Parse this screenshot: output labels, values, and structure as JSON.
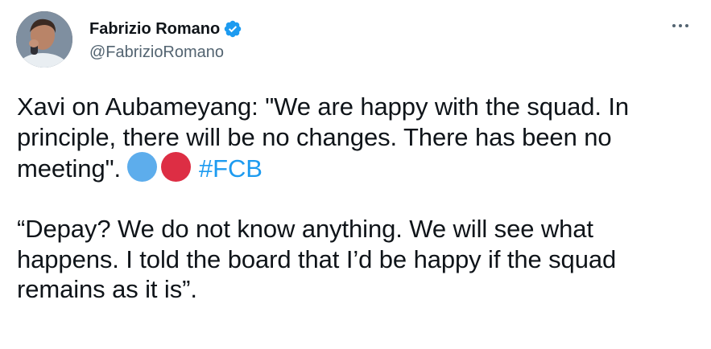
{
  "author": {
    "display_name": "Fabrizio Romano",
    "handle": "@FabrizioRomano",
    "verified": true,
    "verified_color": "#1d9bf0"
  },
  "icons": {
    "avatar": "profile-photo",
    "verified": "verified-badge-icon",
    "more": "more-options-icon"
  },
  "tweet": {
    "paragraph1_text": "Xavi on Aubameyang: \"We are happy with the squad. In principle, there will be no changes. There has been no meeting\".",
    "emoji1": "blue-circle",
    "emoji2": "red-circle",
    "hashtag": "#FCB",
    "paragraph2_text": "“Depay? We do not know anything. We will see what happens. I told the board that I’d be happy if the squad remains as it is”."
  },
  "colors": {
    "text": "#0f1419",
    "secondary_text": "#536471",
    "link": "#1d9bf0",
    "emoji_blue": "#5dadec",
    "emoji_red": "#dd2e44"
  }
}
